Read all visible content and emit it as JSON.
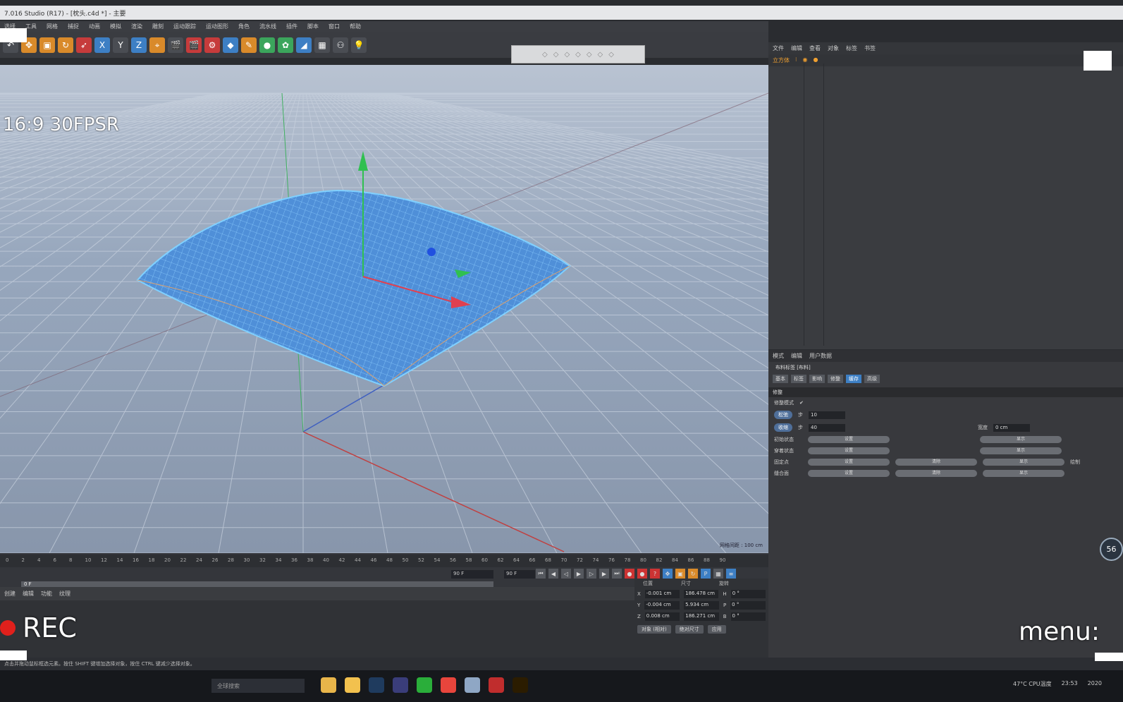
{
  "window": {
    "title": "7.016 Studio (R17) - [枕头.c4d *] - 主要"
  },
  "menu": [
    "选择",
    "工具",
    "网格",
    "捕捉",
    "动画",
    "模拟",
    "渲染",
    "雕刻",
    "运动跟踪",
    "运动图形",
    "角色",
    "流水线",
    "插件",
    "脚本",
    "窗口",
    "帮助"
  ],
  "toolbar": {
    "x_label": "X",
    "y_label": "Y",
    "z_label": "Z"
  },
  "overlay": {
    "format": "16:9 30FPSR",
    "rec": "REC",
    "menu": "menu:",
    "fps": "56"
  },
  "viewport": {
    "status": "网格间距 : 100 cm"
  },
  "timeline": {
    "ticks": [
      "0",
      "2",
      "4",
      "6",
      "8",
      "10",
      "12",
      "14",
      "16",
      "18",
      "20",
      "22",
      "24",
      "26",
      "28",
      "30",
      "32",
      "34",
      "36",
      "38",
      "40",
      "42",
      "44",
      "46",
      "48",
      "50",
      "52",
      "54",
      "56",
      "58",
      "60",
      "62",
      "64",
      "66",
      "68",
      "70",
      "72",
      "74",
      "76",
      "78",
      "80",
      "82",
      "84",
      "86",
      "88",
      "90"
    ],
    "current_frame": "0 F",
    "end_frame": "90 F",
    "min_frame": "90 F",
    "scrub_label": "0 F"
  },
  "material_panel": {
    "tabs": [
      "创建",
      "编辑",
      "功能",
      "纹理"
    ]
  },
  "coords": {
    "headers": [
      "位置",
      "尺寸",
      "旋转"
    ],
    "rows": [
      {
        "axis": "X",
        "pos": "-0.001 cm",
        "size": "186.478 cm",
        "rot_axis": "H",
        "rot": "0 °"
      },
      {
        "axis": "Y",
        "pos": "-0.004 cm",
        "size": "5.934 cm",
        "rot_axis": "P",
        "rot": "0 °"
      },
      {
        "axis": "Z",
        "pos": "0.008 cm",
        "size": "186.271 cm",
        "rot_axis": "B",
        "rot": "0 °"
      }
    ],
    "btn_object": "对象 (相对)",
    "btn_size": "绝对尺寸",
    "btn_apply": "应用"
  },
  "objects_panel": {
    "tabs": [
      "文件",
      "编辑",
      "查看",
      "对象",
      "标签",
      "书签"
    ],
    "object_name": "立方体"
  },
  "attributes": {
    "tabs": [
      "模式",
      "编辑",
      "用户数据"
    ],
    "object": "布料标签 [布料]",
    "subtabs": [
      "基本",
      "标签",
      "影响",
      "修整",
      "缓存",
      "高级"
    ],
    "section": "修整",
    "mode_label": "修整模式",
    "rows": [
      {
        "btn": "松弛",
        "step_label": "步",
        "step": "10"
      },
      {
        "btn": "收缩",
        "step_label": "步",
        "step": "40",
        "width_label": "宽度",
        "width": "0 cm"
      }
    ],
    "init_state": "初始状态",
    "set": "设置",
    "show": "显示",
    "fix_point": "固定点",
    "clear": "清除",
    "draw": "绘制",
    "dress_state": "穿着状态",
    "seam": "缝合面"
  },
  "statusbar": {
    "text": "点击并拖动鼠标框选元素。按住 SHIFT 键增加选择对象，按住 CTRL 键减少选择对象。"
  },
  "taskbar": {
    "search": "全球搜索",
    "cpu": "47°C CPU温度",
    "time": "23:53",
    "date": "2020"
  },
  "colors": {
    "accent": "#3d7fc4",
    "rec": "#e0201c",
    "mesh": "#4f9be8"
  }
}
